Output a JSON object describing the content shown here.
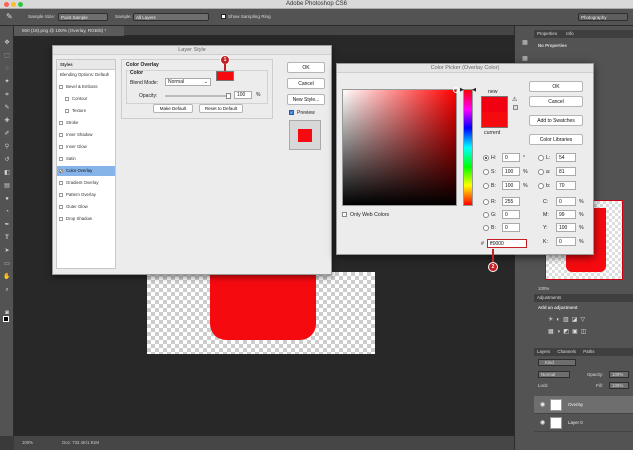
{
  "app": {
    "title": "Adobe Photoshop CS6",
    "workspace": "Photography"
  },
  "options_bar": {
    "sample_size_label": "Sample Size:",
    "sample_size_value": "Point Sample",
    "sample_label": "Sample:",
    "sample_value": "All Layers",
    "sampling_ring_label": "Show Sampling Ring"
  },
  "document": {
    "tab_label": "500 (19).png @ 100% (Overlay, RGB/8) *",
    "status_zoom": "100%",
    "status_doc": "Doc: 732.4K/1.91M"
  },
  "layer_style": {
    "title": "Layer Style",
    "styles_header": "Styles",
    "items": [
      {
        "label": "Blending Options: Default",
        "check": false,
        "indent": false,
        "selected": false
      },
      {
        "label": "Bevel & Emboss",
        "check": true,
        "on": false,
        "indent": false,
        "selected": false
      },
      {
        "label": "Contour",
        "check": true,
        "on": false,
        "indent": true,
        "selected": false
      },
      {
        "label": "Texture",
        "check": true,
        "on": false,
        "indent": true,
        "selected": false
      },
      {
        "label": "Stroke",
        "check": true,
        "on": false,
        "indent": false,
        "selected": false
      },
      {
        "label": "Inner Shadow",
        "check": true,
        "on": false,
        "indent": false,
        "selected": false
      },
      {
        "label": "Inner Glow",
        "check": true,
        "on": false,
        "indent": false,
        "selected": false
      },
      {
        "label": "Satin",
        "check": true,
        "on": false,
        "indent": false,
        "selected": false
      },
      {
        "label": "Color Overlay",
        "check": true,
        "on": true,
        "indent": false,
        "selected": true
      },
      {
        "label": "Gradient Overlay",
        "check": true,
        "on": false,
        "indent": false,
        "selected": false
      },
      {
        "label": "Pattern Overlay",
        "check": true,
        "on": false,
        "indent": false,
        "selected": false
      },
      {
        "label": "Outer Glow",
        "check": true,
        "on": false,
        "indent": false,
        "selected": false
      },
      {
        "label": "Drop Shadow",
        "check": true,
        "on": false,
        "indent": false,
        "selected": false
      }
    ],
    "section_title": "Color Overlay",
    "group_title": "Color",
    "blend_mode_label": "Blend Mode:",
    "blend_mode_value": "Normal",
    "opacity_label": "Opacity:",
    "opacity_value": "100",
    "opacity_unit": "%",
    "make_default": "Make Default",
    "reset_default": "Reset to Default",
    "ok": "OK",
    "cancel": "Cancel",
    "new_style": "New Style...",
    "preview": "Preview",
    "overlay_color": "#f50a10"
  },
  "color_picker": {
    "title": "Color Picker (Overlay Color)",
    "new_label": "new",
    "current_label": "current",
    "ok": "OK",
    "cancel": "Cancel",
    "add_swatches": "Add to Swatches",
    "color_libraries": "Color Libraries",
    "only_web": "Only Web Colors",
    "h_label": "H:",
    "h_value": "0",
    "h_unit": "°",
    "s_label": "S:",
    "s_value": "100",
    "s_unit": "%",
    "b_label": "B:",
    "b_value": "100",
    "b_unit": "%",
    "r_label": "R:",
    "r_value": "255",
    "g_label": "G:",
    "g_value": "0",
    "bl_label": "B:",
    "bl_value": "0",
    "l_label": "L:",
    "l_value": "54",
    "a_label": "a:",
    "a_value": "81",
    "b2_label": "b:",
    "b2_value": "70",
    "c_label": "C:",
    "c_value": "0",
    "c_unit": "%",
    "m_label": "M:",
    "m_value": "99",
    "m_unit": "%",
    "y_label": "Y:",
    "y_value": "100",
    "y_unit": "%",
    "k_label": "K:",
    "k_value": "0",
    "k_unit": "%",
    "hex_label": "#",
    "hex_value": "ff0000",
    "new_color": "#f00010",
    "current_color": "#f50a10"
  },
  "markers": {
    "one": "1",
    "two": "2"
  },
  "panels": {
    "properties_tab": "Properties",
    "info_tab": "Info",
    "no_properties": "No Properties",
    "zoom_value": "100%",
    "adjustments_tab": "Adjustments",
    "add_adjustment": "Add an adjustment",
    "layers_tab": "Layers",
    "channels_tab": "Channels",
    "paths_tab": "Paths",
    "kind_label": "Kind",
    "blend_value": "Normal",
    "opacity_label": "Opacity:",
    "opacity_value": "100%",
    "lock_label": "Lock:",
    "fill_label": "Fill:",
    "fill_value": "100%",
    "layers": [
      {
        "name": "Overlay",
        "selected": true
      },
      {
        "name": "Layer 0",
        "selected": false
      }
    ]
  }
}
